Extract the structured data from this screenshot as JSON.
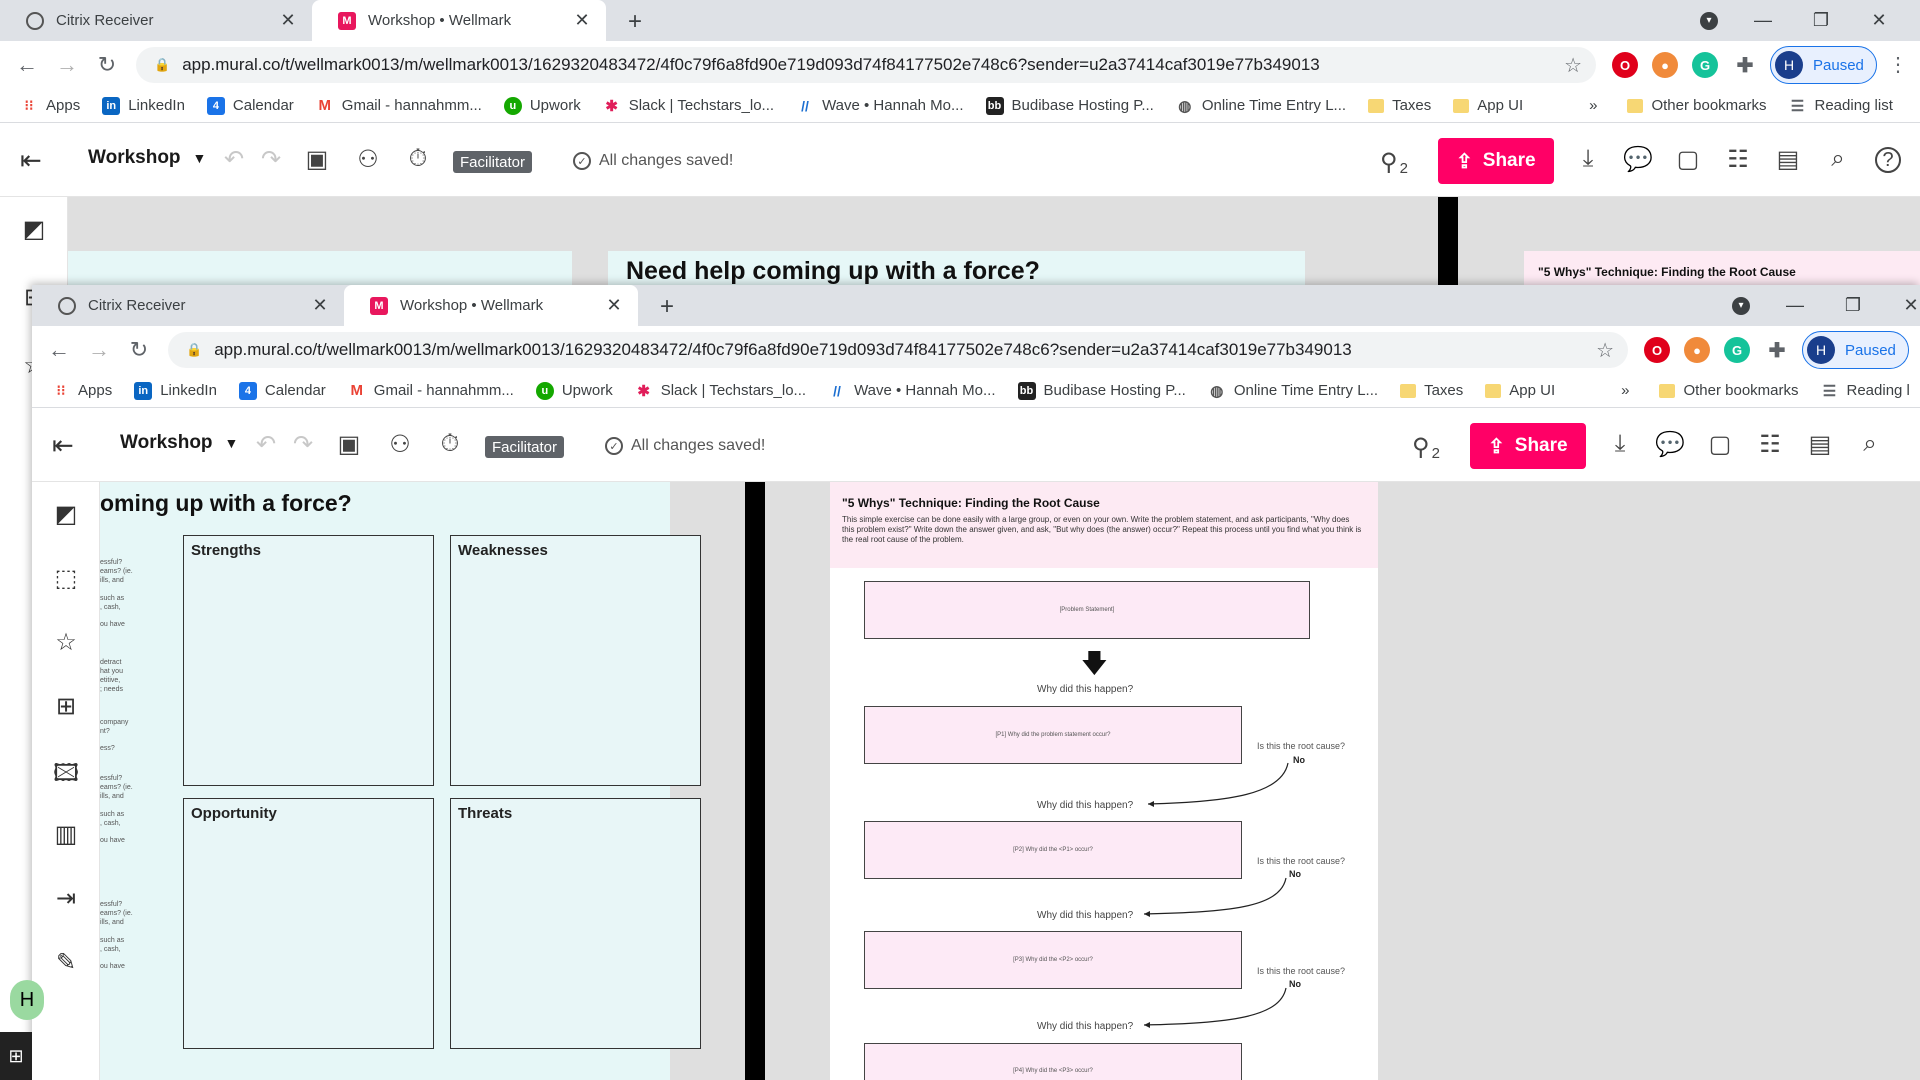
{
  "browser": {
    "tabs": [
      {
        "title": "Citrix Receiver"
      },
      {
        "title": "Workshop • Wellmark"
      }
    ],
    "url": "app.mural.co/t/wellmark0013/m/wellmark0013/1629320483472/4f0c79f6a8fd90e719d093d74f84177502e748c6?sender=u2a37414caf3019e77b349013",
    "profile_initial": "H",
    "profile_status": "Paused",
    "bookmarks": [
      {
        "label": "Apps",
        "icon": "apps-grid-icon"
      },
      {
        "label": "LinkedIn",
        "icon": "linkedin-icon"
      },
      {
        "label": "Calendar",
        "icon": "calendar-icon"
      },
      {
        "label": "Gmail - hannahmm...",
        "icon": "gmail-icon"
      },
      {
        "label": "Upwork",
        "icon": "upwork-icon"
      },
      {
        "label": "Slack | Techstars_lo...",
        "icon": "slack-icon"
      },
      {
        "label": "Wave • Hannah Mo...",
        "icon": "wave-icon"
      },
      {
        "label": "Budibase Hosting P...",
        "icon": "budibase-icon"
      },
      {
        "label": "Online Time Entry L...",
        "icon": "globe-icon"
      },
      {
        "label": "Taxes",
        "icon": "folder-icon"
      },
      {
        "label": "App UI",
        "icon": "folder-icon"
      }
    ],
    "bookmarks_overflow": "»",
    "other_bookmarks": "Other bookmarks",
    "reading_list": "Reading list",
    "reading_list_cut": "Reading l"
  },
  "mural": {
    "title": "Workshop",
    "facilitator": "Facilitator",
    "saved_status": "All changes saved!",
    "user_count": "2",
    "share_label": "Share",
    "help_label": "?"
  },
  "canvas": {
    "force_heading_full": "Need help coming up with a force?",
    "force_heading_cut": "oming up with a force?",
    "swot": {
      "strengths": "Strengths",
      "weaknesses": "Weaknesses",
      "opportunity": "Opportunity",
      "threats": "Threats"
    },
    "side_notes": [
      "essful?\neams? (ie.\nills, and",
      "such as\n, cash,",
      "ou have",
      "detract\nhat you\netitive,\n; needs",
      "company\nnt?",
      "ess?",
      "essful?\neams? (ie.\nills, and",
      "such as\n, cash,",
      "ou have",
      "essful?\neams? (ie.\nills, and",
      "such as\n, cash,",
      "ou have"
    ],
    "five_whys": {
      "title": "\"5 Whys\" Technique: Finding the Root Cause",
      "description": "This simple exercise can be done easily with a large group, or even on your own. Write the problem statement, and ask participants, \"Why does this problem exist?\" Write down the answer given, and ask, \"But why does (the answer) occur?\" Repeat this process until you find what you think is the real root cause of the problem.",
      "problem_statement": "[Problem Statement]",
      "why_label": "Why did this happen?",
      "root_cause_q": "Is this the root cause?",
      "no_label": "No",
      "boxes": [
        "[P1] Why did the problem statement occur?",
        "[P2] Why did the <P1> occur?",
        "[P3] Why did the <P2> occur?",
        "[P4] Why did the <P3> occur?"
      ]
    }
  },
  "taskbar": {
    "avatar_initial": "H"
  }
}
